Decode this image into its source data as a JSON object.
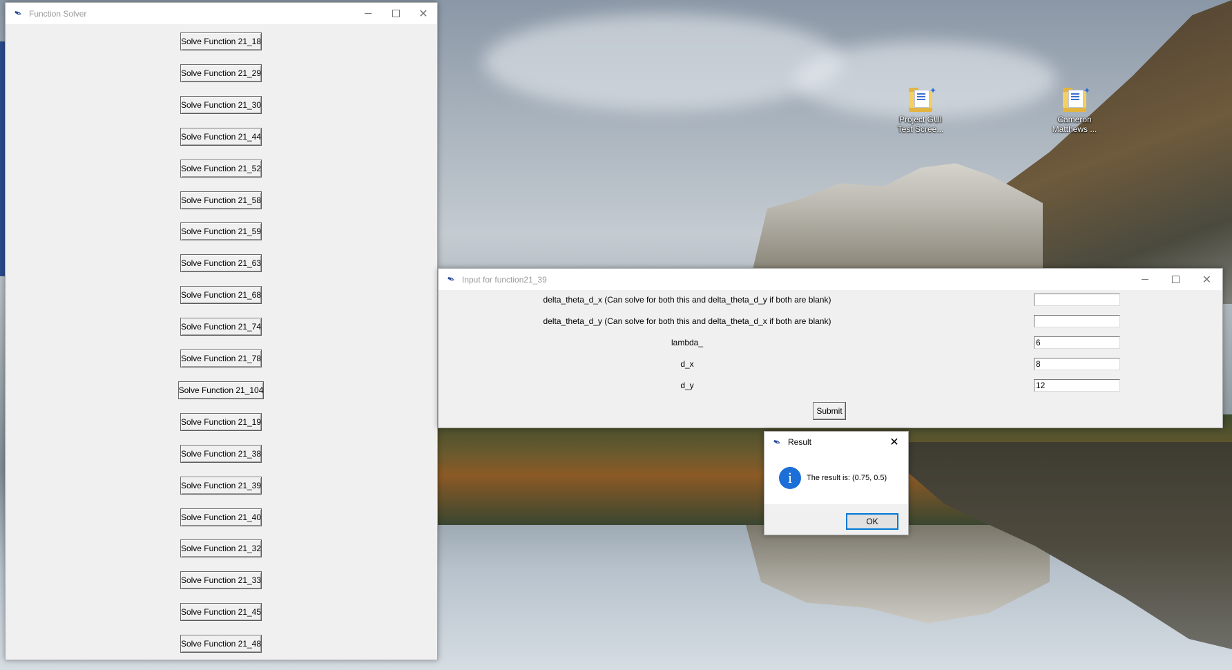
{
  "desktop": {
    "icons": [
      {
        "label": "Project GUI Test Scree...",
        "icon": "folder-shortcut-icon"
      },
      {
        "label": "Cameron Matthews ...",
        "icon": "folder-shortcut-icon"
      }
    ]
  },
  "main_window": {
    "title": "Function Solver",
    "buttons": [
      "Solve Function 21_18",
      "Solve Function 21_29",
      "Solve Function 21_30",
      "Solve Function 21_44",
      "Solve Function 21_52",
      "Solve Function 21_58",
      "Solve Function 21_59",
      "Solve Function 21_63",
      "Solve Function 21_68",
      "Solve Function 21_74",
      "Solve Function 21_78",
      "Solve Function 21_104",
      "Solve Function 21_19",
      "Solve Function 21_38",
      "Solve Function 21_39",
      "Solve Function 21_40",
      "Solve Function 21_32",
      "Solve Function 21_33",
      "Solve Function 21_45",
      "Solve Function 21_48"
    ]
  },
  "input_window": {
    "title": "Input for function21_39",
    "fields": [
      {
        "label": "delta_theta_d_x (Can solve for both this and delta_theta_d_y if both are blank)",
        "value": ""
      },
      {
        "label": "delta_theta_d_y (Can solve for both this and delta_theta_d_x if both are blank)",
        "value": ""
      },
      {
        "label": "lambda_",
        "value": "6"
      },
      {
        "label": "d_x",
        "value": "8"
      },
      {
        "label": "d_y",
        "value": "12"
      }
    ],
    "submit_label": "Submit"
  },
  "result_dialog": {
    "title": "Result",
    "message": "The result is: (0.75, 0.5)",
    "ok_label": "OK",
    "icon": "info-icon"
  },
  "colors": {
    "window_bg": "#f0f0f0",
    "info_blue": "#1c6fd6",
    "focus_blue": "#0078d7"
  }
}
